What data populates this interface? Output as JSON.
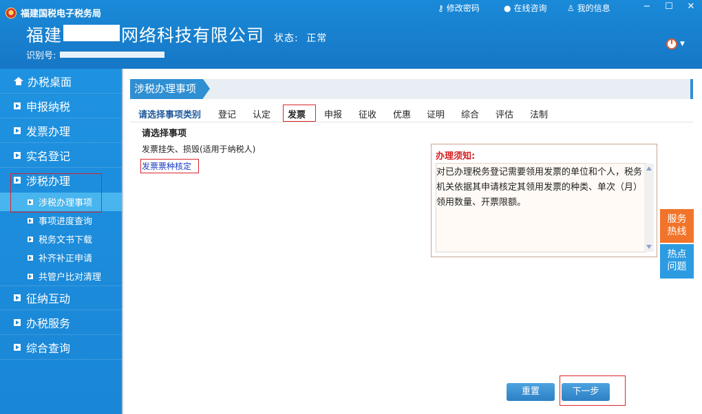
{
  "header": {
    "app_title": "福建国税电子税务局",
    "company_prefix": "福建",
    "company_suffix": "网络科技有限公司",
    "status_label": "状态:",
    "status_value": "正常",
    "taxid_label": "识别号:",
    "links": [
      {
        "icon": "key-icon",
        "label": "修改密码"
      },
      {
        "icon": "chat-icon",
        "label": "在线咨询"
      },
      {
        "icon": "user-icon",
        "label": "我的信息"
      }
    ],
    "window_controls": [
      "−",
      "☐",
      "✕"
    ]
  },
  "sidebar": {
    "items": [
      {
        "label": "办税桌面",
        "icon": "home-icon"
      },
      {
        "label": "申报纳税",
        "icon": "arrow-bullet-icon"
      },
      {
        "label": "发票办理",
        "icon": "arrow-bullet-icon"
      },
      {
        "label": "实名登记",
        "icon": "arrow-bullet-icon"
      },
      {
        "label": "涉税办理",
        "icon": "arrow-bullet-icon"
      }
    ],
    "sub_items": [
      {
        "label": "涉税办理事项"
      },
      {
        "label": "事项进度查询"
      },
      {
        "label": "税务文书下载"
      },
      {
        "label": "补齐补正申请"
      },
      {
        "label": "共管户比对清理"
      }
    ],
    "items_after": [
      {
        "label": "征纳互动"
      },
      {
        "label": "办税服务"
      },
      {
        "label": "综合查询"
      }
    ]
  },
  "main": {
    "heading": "涉税办理事项",
    "category_prompt": "请选择事项类别",
    "categories": [
      "登记",
      "认定",
      "发票",
      "申报",
      "征收",
      "优惠",
      "证明",
      "综合",
      "评估",
      "法制"
    ],
    "selected_category": "发票",
    "section_title": "请选择事项",
    "matters": [
      "发票挂失、损毁(适用于纳税人)",
      "发票票种核定"
    ],
    "notice_title": "办理须知:",
    "notice_body": "对已办理税务登记需要领用发票的单位和个人，税务机关依据其申请核定其领用发票的种类、单次（月）领用数量、开票限额。",
    "buttons": {
      "reset": "重置",
      "next": "下一步"
    },
    "side_tabs": {
      "hotline": "服务热线",
      "faq": "热点问题"
    }
  },
  "colors": {
    "header_blue": "#1a86d6",
    "highlight_red": "#d9252a",
    "hotline_orange": "#f2742a"
  }
}
